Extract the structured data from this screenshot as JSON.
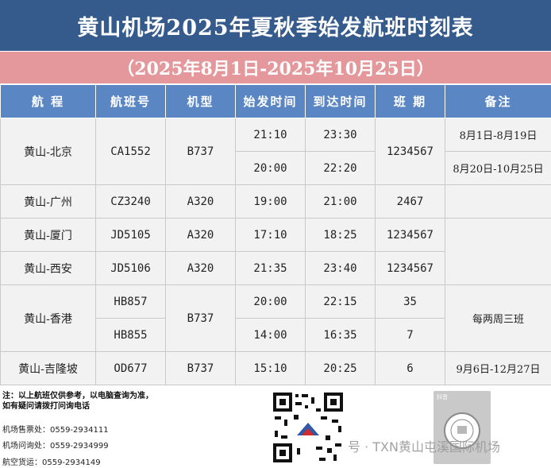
{
  "title": "黄山机场2025年夏秋季始发航班时刻表",
  "date_range": "（2025年8月1日-2025年10月25日）",
  "headers": [
    "航 程",
    "航班号",
    "机型",
    "始发时间",
    "到达时间",
    "班 期",
    "备注"
  ],
  "rows": [
    {
      "route": "黄山-北京",
      "flight": "CA1552",
      "aircraft": "B737",
      "dep1": "21:10",
      "arr1": "23:30",
      "dep2": "20:00",
      "arr2": "22:20",
      "days": "1234567",
      "note1": "8月1日-8月19日",
      "note2": "8月20日-10月25日"
    },
    {
      "route": "黄山-广州",
      "flight": "CZ3240",
      "aircraft": "A320",
      "dep": "19:00",
      "arr": "21:00",
      "days": "2467"
    },
    {
      "route": "黄山-厦门",
      "flight": "JD5105",
      "aircraft": "A320",
      "dep": "17:10",
      "arr": "18:25",
      "days": "1234567"
    },
    {
      "route": "黄山-西安",
      "flight": "JD5106",
      "aircraft": "A320",
      "dep": "21:35",
      "arr": "23:40",
      "days": "1234567"
    },
    {
      "route": "黄山-香港",
      "flight1": "HB857",
      "flight2": "HB855",
      "aircraft": "B737",
      "dep1": "20:00",
      "arr1": "22:15",
      "days1": "35",
      "dep2": "14:00",
      "arr2": "16:35",
      "days2": "7",
      "note": "每两周三班"
    },
    {
      "route": "黄山-吉隆坡",
      "flight": "OD677",
      "aircraft": "B737",
      "dep": "15:10",
      "arr": "20:25",
      "days": "6",
      "note": "9月6日-12月27日"
    }
  ],
  "footer": {
    "note_line1": "注：以上航班仅供参考，以电脑查询为准，",
    "note_line2": "如有疑问请拨打问询电话",
    "contacts": [
      {
        "label": "机场售票处：",
        "phone": "0559-2934111"
      },
      {
        "label": "机场问询处：",
        "phone": "0559-2934999"
      },
      {
        "label": "航空货运：",
        "phone": "0559-2934149"
      }
    ],
    "tiktok_label": "抖音",
    "watermark": "号 · TXN黄山屯溪国际机场"
  },
  "colors": {
    "title_bg": "#355a8c",
    "date_bg": "#e5989b",
    "header_bg": "#5a86c4",
    "cell_bg": "#f2f2f2"
  }
}
